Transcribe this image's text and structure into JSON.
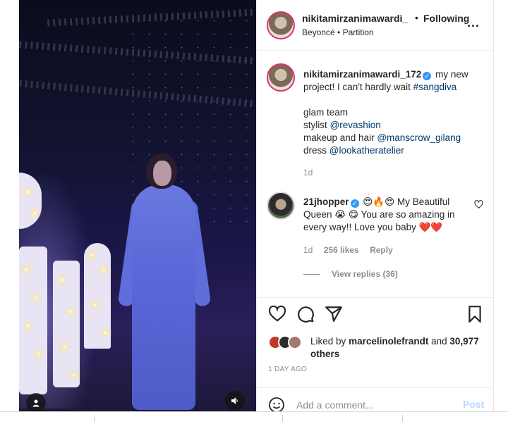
{
  "header": {
    "username": "nikitamirzanimawardi_",
    "separator": "•",
    "follow_status": "Following",
    "audio": "Beyoncé • Partition",
    "more": "..."
  },
  "caption": {
    "username": "nikitamirzanimawardi_172",
    "text": "my new project! I can't hardly wait",
    "hashtag": "#sangdiva",
    "lines": [
      {
        "prefix": "glam team",
        "tag": ""
      },
      {
        "prefix": "stylist ",
        "tag": "@revashion"
      },
      {
        "prefix": "makeup and hair ",
        "tag": "@manscrow_gilang"
      },
      {
        "prefix": "dress ",
        "tag": "@lookatheratelier"
      }
    ],
    "time": "1d"
  },
  "comment": {
    "username": "21jhopper",
    "emoji_lead": "😍🔥😍",
    "text_1": "My Beautiful Queen",
    "emoji_mid": "😭 😋",
    "text_2": "You are so amazing in every way!! Love you baby",
    "emoji_end": "❤️❤️",
    "time": "1d",
    "likes": "256 likes",
    "reply": "Reply",
    "view_replies": "View replies (36)"
  },
  "likes": {
    "prefix": "Liked by",
    "user": "marcelinolefrandt",
    "middle": "and",
    "others": "30,977 others"
  },
  "posted": "1 DAY AGO",
  "add_comment": {
    "placeholder": "Add a comment...",
    "post": "Post"
  },
  "icons": {
    "like": "heart-icon",
    "comment": "comment-icon",
    "share": "paper-plane-icon",
    "save": "bookmark-icon",
    "emoji": "smiley-icon",
    "tag_user": "user-tag-icon",
    "audio": "speaker-icon"
  },
  "colors": {
    "verified": "#3897f0",
    "link": "#00376b",
    "post_disabled": "#b3dbff",
    "story_ring": "#e1306c"
  }
}
